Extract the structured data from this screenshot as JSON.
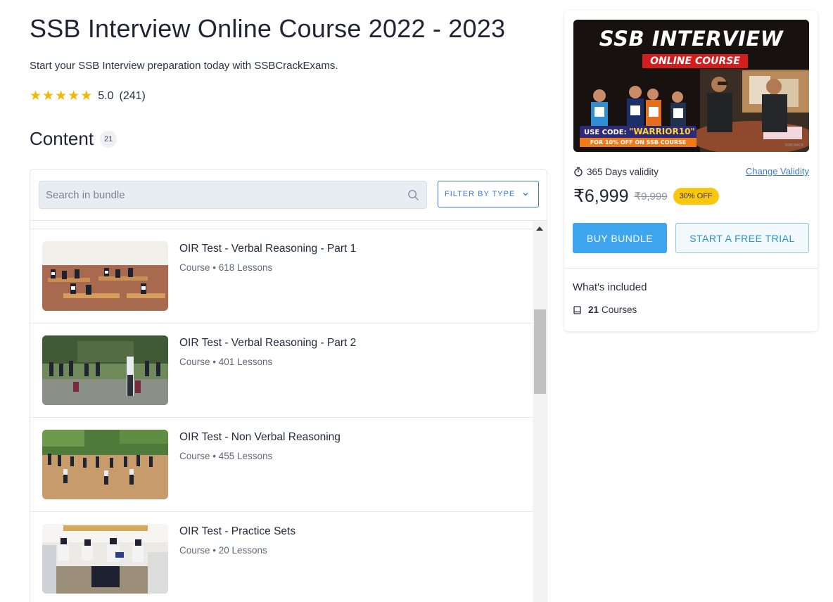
{
  "page": {
    "title": "SSB Interview Online Course 2022 - 2023",
    "subtitle": "Start your SSB Interview preparation today with SSBCrackExams.",
    "rating": {
      "stars": 5,
      "value": "5.0",
      "count": "(241)"
    }
  },
  "content": {
    "heading": "Content",
    "count": "21",
    "search_placeholder": "Search in bundle",
    "filter_label": "FILTER BY TYPE",
    "items": [
      {
        "title": "OIR Test - Verbal Reasoning - Part 1",
        "meta": "Course • 618 Lessons"
      },
      {
        "title": "OIR Test - Verbal Reasoning - Part 2",
        "meta": "Course • 401 Lessons"
      },
      {
        "title": "OIR Test - Non Verbal Reasoning",
        "meta": "Course • 455 Lessons"
      },
      {
        "title": "OIR Test - Practice Sets",
        "meta": "Course • 20 Lessons"
      }
    ]
  },
  "sidebar": {
    "banner": {
      "title": "SSB INTERVIEW",
      "ribbon": "ONLINE COURSE",
      "code_prefix": "USE CODE: ",
      "code": "\"WARRIOR10\"",
      "offer": "FOR 10% OFF ON SSB COURSE",
      "brand": "SSBCRACK"
    },
    "validity": "365 Days validity",
    "change_validity": "Change Validity",
    "price": "₹6,999",
    "old_price": "₹9,999",
    "discount": "30% OFF",
    "buy_label": "BUY BUNDLE",
    "trial_label": "START A FREE TRIAL",
    "included_title": "What's included",
    "included_count": "21",
    "included_label": "Courses"
  },
  "colors": {
    "accent_blue": "#3c79d4",
    "buy_button": "#3da6ee",
    "star": "#f5b700",
    "discount_badge": "#f9c80e"
  },
  "icons": [
    "star-icon",
    "search-icon",
    "chevron-down-icon",
    "timer-icon",
    "book-icon",
    "scroll-up-arrow"
  ]
}
